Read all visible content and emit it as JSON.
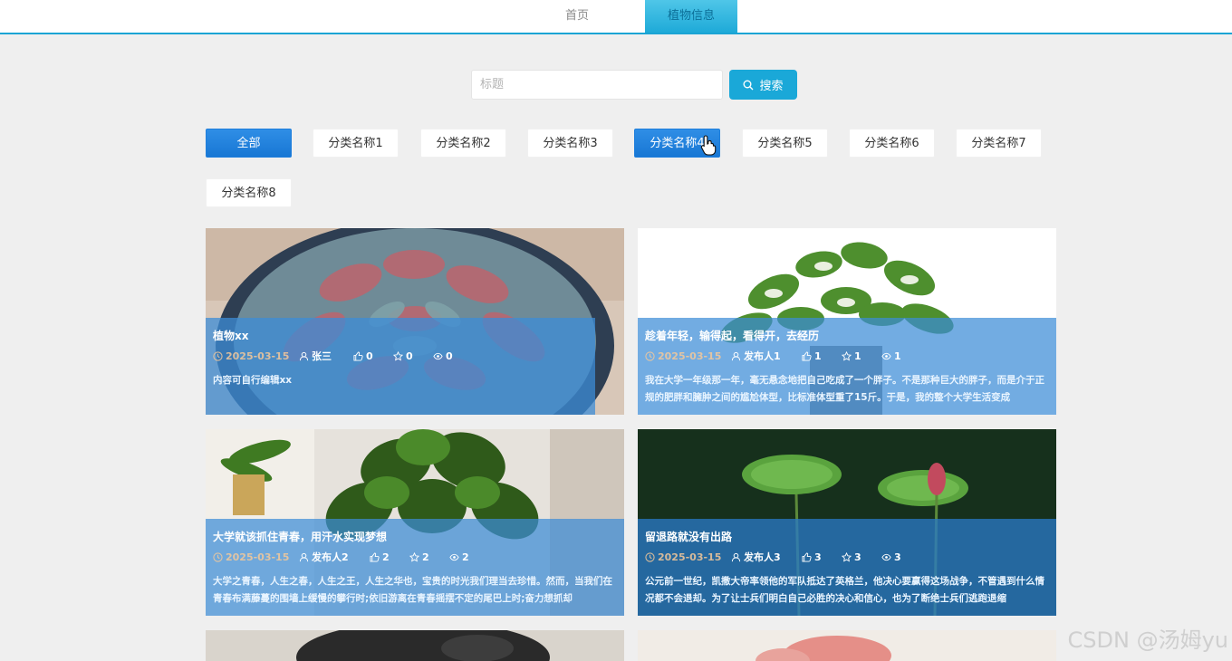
{
  "nav": {
    "home": "首页",
    "plant_info": "植物信息"
  },
  "search": {
    "placeholder": "标题",
    "value": "",
    "button": "搜索"
  },
  "categories": [
    "全部",
    "分类名称1",
    "分类名称2",
    "分类名称3",
    "分类名称4",
    "分类名称5",
    "分类名称6",
    "分类名称7",
    "分类名称8"
  ],
  "cards": [
    {
      "title": "植物xx",
      "date": "2025-03-15",
      "author": "张三",
      "likes": "0",
      "favorites": "0",
      "views": "0",
      "desc": "内容可自行编辑xx"
    },
    {
      "title": "趁着年轻，输得起，看得开，去经历",
      "date": "2025-03-15",
      "author": "发布人1",
      "likes": "1",
      "favorites": "1",
      "views": "1",
      "desc": "我在大学一年级那一年，毫无悬念地把自己吃成了一个胖子。不是那种巨大的胖子，而是介于正规的肥胖和臃肿之间的尴尬体型，比标准体型重了15斤。于是，我的整个大学生活变成"
    },
    {
      "title": "大学就该抓住青春，用汗水实现梦想",
      "date": "2025-03-15",
      "author": "发布人2",
      "likes": "2",
      "favorites": "2",
      "views": "2",
      "desc": "大学之青春，人生之春，人生之王，人生之华也，宝贵的时光我们理当去珍惜。然而，当我们在青春布满藤蔓的围墙上缓慢的攀行时;依旧游离在青春摇摆不定的尾巴上时;奋力想抓却"
    },
    {
      "title": "留退路就没有出路",
      "date": "2025-03-15",
      "author": "发布人3",
      "likes": "3",
      "favorites": "3",
      "views": "3",
      "desc": "公元前一世纪，凯撒大帝率领他的军队抵达了英格兰，他决心要赢得这场战争，不管遇到什么情况都不会退却。为了让士兵们明白自己必胜的决心和信心，也为了断绝士兵们逃跑退缩"
    }
  ],
  "watermark": "CSDN @汤姆yu"
}
